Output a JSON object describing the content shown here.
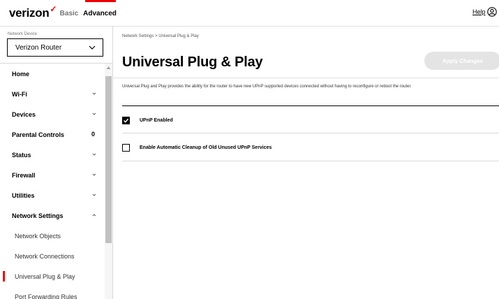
{
  "header": {
    "logo_text": "verizon",
    "tabs": {
      "basic": "Basic",
      "advanced": "Advanced"
    },
    "help_label": "Help"
  },
  "sidebar": {
    "device_label": "Network Device",
    "device_value": "Verizon Router",
    "items": [
      {
        "label": "Home"
      },
      {
        "label": "Wi-Fi"
      },
      {
        "label": "Devices"
      },
      {
        "label": "Parental Controls",
        "badge": "0"
      },
      {
        "label": "Status"
      },
      {
        "label": "Firewall"
      },
      {
        "label": "Utilities"
      },
      {
        "label": "Network Settings"
      }
    ],
    "sub_items": [
      {
        "label": "Network Objects"
      },
      {
        "label": "Network Connections"
      },
      {
        "label": "Universal Plug & Play",
        "active": true
      },
      {
        "label": "Port Forwarding Rules"
      }
    ]
  },
  "main": {
    "breadcrumb": "Network Settings  >  Universal Plug & Play",
    "title": "Universal Plug & Play",
    "apply_label": "Apply Changes",
    "description": "Universal Plug and Play provides the ability for the router to have new UPnP supported devices connected without having to reconfigure or reboot the router.",
    "options": [
      {
        "label": "UPnP Enabled",
        "checked": true
      },
      {
        "label": "Enable Automatic Cleanup of Old Unused UPnP Services",
        "checked": false
      }
    ]
  },
  "colors": {
    "accent": "#ee0000",
    "apply_disabled": "#e4e4e4"
  }
}
